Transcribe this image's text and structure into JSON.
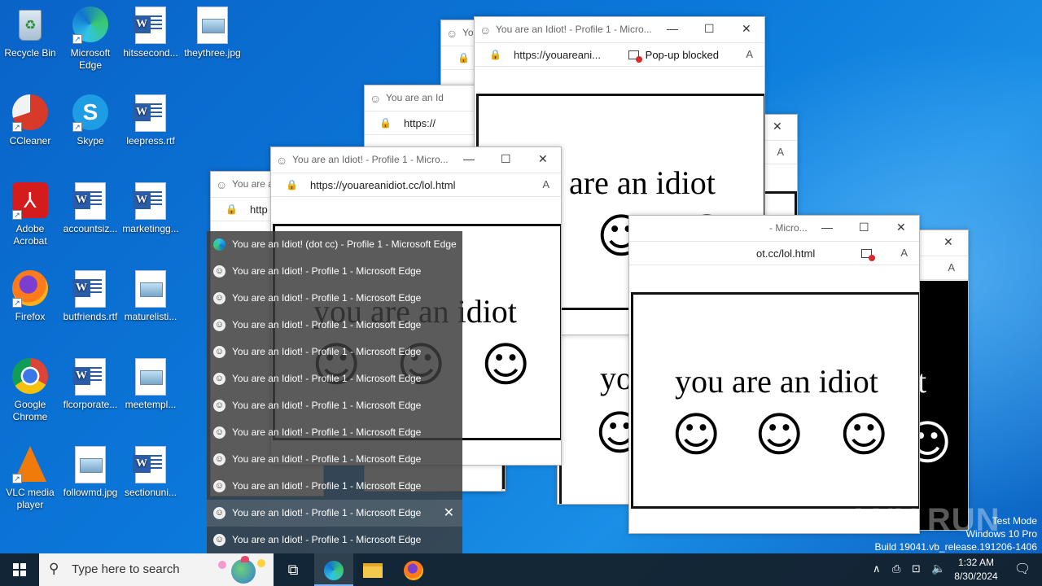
{
  "desktop": {
    "icons": [
      {
        "label": "Recycle Bin",
        "icon": "recycle-bin-icon"
      },
      {
        "label": "Microsoft Edge",
        "icon": "edge-icon"
      },
      {
        "label": "hitssecond...",
        "icon": "word-doc-icon"
      },
      {
        "label": "theythree.jpg",
        "icon": "image-file-icon"
      },
      {
        "label": "CCleaner",
        "icon": "ccleaner-icon"
      },
      {
        "label": "Skype",
        "icon": "skype-icon"
      },
      {
        "label": "leepress.rtf",
        "icon": "word-doc-icon"
      },
      {
        "label": "Adobe Acrobat",
        "icon": "acrobat-icon"
      },
      {
        "label": "accountsiz...",
        "icon": "word-doc-icon"
      },
      {
        "label": "marketingg...",
        "icon": "word-doc-icon"
      },
      {
        "label": "Firefox",
        "icon": "firefox-icon"
      },
      {
        "label": "butfriends.rtf",
        "icon": "word-doc-icon"
      },
      {
        "label": "maturelisti...",
        "icon": "image-file-icon"
      },
      {
        "label": "Google Chrome",
        "icon": "chrome-icon"
      },
      {
        "label": "flcorporate...",
        "icon": "word-doc-icon"
      },
      {
        "label": "meetempl...",
        "icon": "image-file-icon"
      },
      {
        "label": "VLC media player",
        "icon": "vlc-icon"
      },
      {
        "label": "followmd.jpg",
        "icon": "image-file-icon"
      },
      {
        "label": "sectionuni...",
        "icon": "word-doc-icon"
      }
    ]
  },
  "windows": {
    "title_full": "You are an Idiot! - Profile 1 - Micro...",
    "title_short": "You are an Id",
    "title_tiny": "You are a",
    "title_yo": "Yo",
    "title_right": "- Micro...",
    "url_full": "https://youareanidiot.cc/lol.html",
    "url_trunc": "https://youareani...",
    "url_http": "http",
    "url_https": "https://",
    "url_tail": "ot.cc/lol.html",
    "popup_blocked": "Pop-up blocked",
    "idiot_text": "you are an idiot",
    "idiot_text_tail": "u are an idiot",
    "idiot_yo": "yo",
    "idiot_t": "t",
    "smiley": "☺"
  },
  "jumplist": {
    "items": [
      "You are an Idiot! (dot cc) - Profile 1 - Microsoft Edge",
      "You are an Idiot! - Profile 1 - Microsoft Edge",
      "You are an Idiot! - Profile 1 - Microsoft Edge",
      "You are an Idiot! - Profile 1 - Microsoft Edge",
      "You are an Idiot! - Profile 1 - Microsoft Edge",
      "You are an Idiot! - Profile 1 - Microsoft Edge",
      "You are an Idiot! - Profile 1 - Microsoft Edge",
      "You are an Idiot! - Profile 1 - Microsoft Edge",
      "You are an Idiot! - Profile 1 - Microsoft Edge",
      "You are an Idiot! - Profile 1 - Microsoft Edge",
      "You are an Idiot! - Profile 1 - Microsoft Edge",
      "You are an Idiot! - Profile 1 - Microsoft Edge"
    ]
  },
  "taskbar": {
    "search_placeholder": "Type here to search",
    "time": "1:32 AM",
    "date": "8/30/2024"
  },
  "watermark": {
    "line1": "Test Mode",
    "line2": "Windows 10 Pro",
    "line3": "Build 19041.vb_release.191206-1406",
    "brand": "ANY RUN"
  },
  "colors": {
    "desktop_blue": "#0b79da",
    "taskbar": "#141e28",
    "jumplist": "#3c3c3c"
  }
}
